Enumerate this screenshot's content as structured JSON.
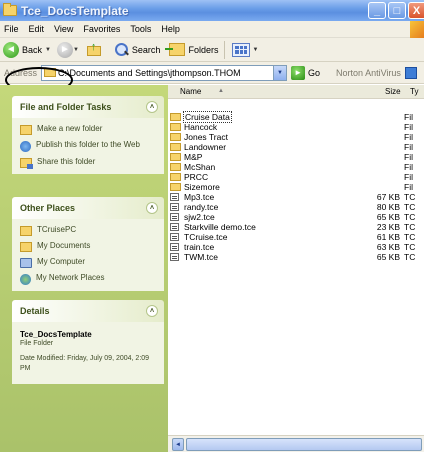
{
  "window": {
    "title": "Tce_DocsTemplate",
    "buttons": {
      "minimize": "_",
      "maximize": "□",
      "close": "X"
    }
  },
  "menu": [
    "File",
    "Edit",
    "View",
    "Favorites",
    "Tools",
    "Help"
  ],
  "toolbar": {
    "back_label": "Back",
    "back_glyph": "◄",
    "forward_glyph": "►",
    "dropdown_glyph": "▼",
    "up_glyph": "↑",
    "search_label": "Search",
    "folders_label": "Folders"
  },
  "address": {
    "label": "Address",
    "value": "C:\\Documents and Settings\\jthompson.THOM",
    "dropdown_glyph": "▼",
    "go_glyph": "►",
    "go_label": "Go",
    "norton_label": "Norton AntiVirus"
  },
  "task_pane": {
    "file_folder_tasks": {
      "title": "File and Folder Tasks",
      "toggle": "˄",
      "items": [
        {
          "label": "Make a new folder",
          "icon": "new-folder-icon"
        },
        {
          "label": "Publish this folder to the Web",
          "icon": "globe-icon"
        },
        {
          "label": "Share this folder",
          "icon": "share-icon"
        }
      ]
    },
    "other_places": {
      "title": "Other Places",
      "toggle": "˄",
      "items": [
        {
          "label": "TCruisePC",
          "icon": "folder-icon"
        },
        {
          "label": "My Documents",
          "icon": "my-documents-icon"
        },
        {
          "label": "My Computer",
          "icon": "computer-icon"
        },
        {
          "label": "My Network Places",
          "icon": "network-icon"
        }
      ]
    },
    "details": {
      "title": "Details",
      "toggle": "˄",
      "name": "Tce_DocsTemplate",
      "type": "File Folder",
      "modified": "Date Modified: Friday, July 09, 2004, 2:09 PM"
    }
  },
  "columns": {
    "name": "Name",
    "sort_glyph": "▲",
    "size": "Size",
    "type": "Ty"
  },
  "files": [
    {
      "name": "Cruise Data",
      "size": "",
      "type": "Fil",
      "kind": "folder"
    },
    {
      "name": "Hancock",
      "size": "",
      "type": "Fil",
      "kind": "folder"
    },
    {
      "name": "Jones Tract",
      "size": "",
      "type": "Fil",
      "kind": "folder"
    },
    {
      "name": "Landowner",
      "size": "",
      "type": "Fil",
      "kind": "folder"
    },
    {
      "name": "M&P",
      "size": "",
      "type": "Fil",
      "kind": "folder"
    },
    {
      "name": "McShan",
      "size": "",
      "type": "Fil",
      "kind": "folder"
    },
    {
      "name": "PRCC",
      "size": "",
      "type": "Fil",
      "kind": "folder"
    },
    {
      "name": "Sizemore",
      "size": "",
      "type": "Fil",
      "kind": "folder"
    },
    {
      "name": "Mp3.tce",
      "size": "67 KB",
      "type": "TC",
      "kind": "file"
    },
    {
      "name": "randy.tce",
      "size": "80 KB",
      "type": "TC",
      "kind": "file"
    },
    {
      "name": "sjw2.tce",
      "size": "65 KB",
      "type": "TC",
      "kind": "file"
    },
    {
      "name": "Starkville demo.tce",
      "size": "23 KB",
      "type": "TC",
      "kind": "file"
    },
    {
      "name": "TCruise.tce",
      "size": "61 KB",
      "type": "TC",
      "kind": "file"
    },
    {
      "name": "train.tce",
      "size": "63 KB",
      "type": "TC",
      "kind": "file"
    },
    {
      "name": "TWM.tce",
      "size": "65 KB",
      "type": "TC",
      "kind": "file"
    }
  ],
  "scrollbar": {
    "left_glyph": "◄"
  }
}
